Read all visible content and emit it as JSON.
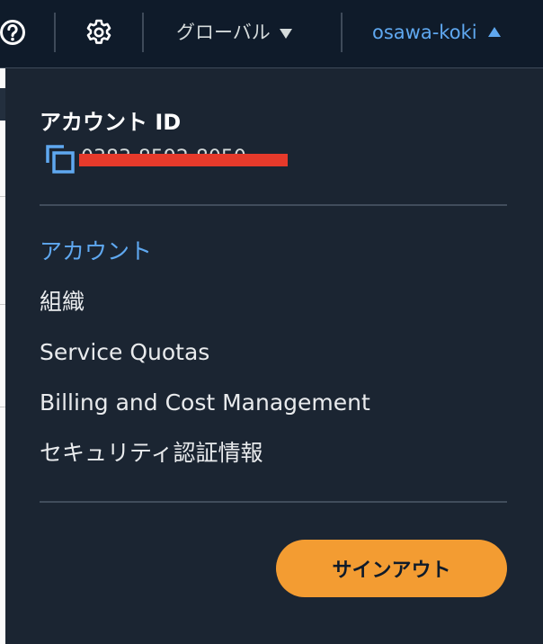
{
  "topbar": {
    "help_icon": "question-circle-icon",
    "settings_icon": "gear-icon",
    "region_label": "グローバル",
    "region_icon": "caret-down-icon",
    "user_label": "osawa-koki",
    "user_icon": "caret-up-icon"
  },
  "account": {
    "title": "アカウント ID",
    "copy_icon": "copy-icon",
    "id_value": "0383-8592-8050"
  },
  "menu": {
    "items": [
      {
        "label": "アカウント",
        "active": true
      },
      {
        "label": "組織"
      },
      {
        "label": "Service Quotas"
      },
      {
        "label": "Billing and Cost Management"
      },
      {
        "label": "セキュリティ認証情報"
      }
    ]
  },
  "signout_label": "サインアウト",
  "colors": {
    "background": "#1b2532",
    "topbar": "#0f1b2a",
    "link": "#5fa8f0",
    "button": "#f39c32",
    "redaction": "#e63a2b"
  }
}
